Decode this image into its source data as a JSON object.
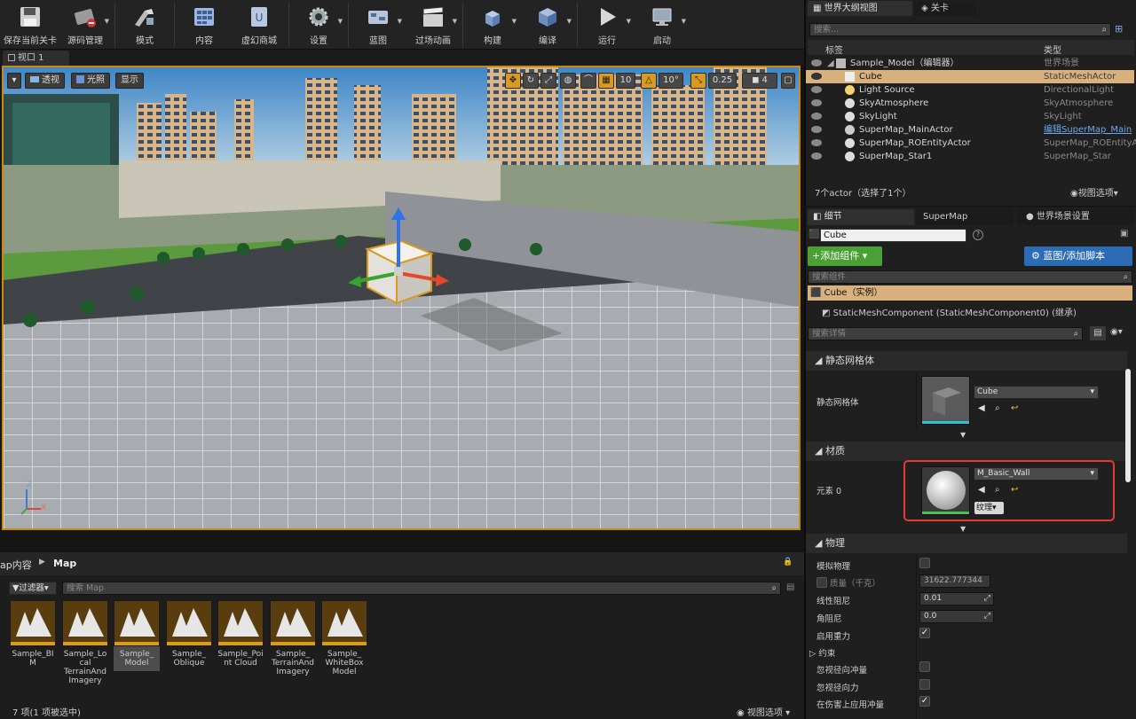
{
  "toolbar": {
    "items": [
      {
        "label": "保存当前关卡",
        "dropdown": false
      },
      {
        "label": "源码管理",
        "dropdown": true
      },
      {
        "label": "模式",
        "dropdown": false
      },
      {
        "label": "内容",
        "dropdown": false
      },
      {
        "label": "虚幻商城",
        "dropdown": false
      },
      {
        "label": "设置",
        "dropdown": true
      },
      {
        "label": "蓝图",
        "dropdown": true
      },
      {
        "label": "过场动画",
        "dropdown": true
      },
      {
        "label": "构建",
        "dropdown": true
      },
      {
        "label": "编译",
        "dropdown": true
      },
      {
        "label": "运行",
        "dropdown": true
      },
      {
        "label": "启动",
        "dropdown": true
      }
    ]
  },
  "viewport": {
    "tab": "视口 1",
    "perspective": "透视",
    "lit": "光照",
    "show": "显示",
    "grid_snap": "10",
    "rot_snap": "10°",
    "scale_snap": "0.25",
    "cam_speed": "4",
    "axis_z": "Z",
    "axis_x": "X",
    "accent": "#c98a14"
  },
  "content_browser": {
    "path_root": "ap内容",
    "path_current": "Map",
    "filter": "过滤器",
    "search_placeholder": "搜索 Map",
    "assets": [
      "Sample_BIM",
      "Sample_Local TerrainAnd Imagery",
      "Sample_ Model",
      "Sample_ Oblique",
      "Sample_Point Cloud",
      "Sample_ TerrainAnd Imagery",
      "Sample_ WhiteBox Model"
    ],
    "status": "7 项(1 项被选中)",
    "view_options": "视图选项"
  },
  "outliner": {
    "tab1": "世界大纲视图",
    "tab2": "关卡",
    "search_placeholder": "搜索...",
    "col_label": "标签",
    "col_type": "类型",
    "rows": [
      {
        "name": "Sample_Model（编辑器）",
        "type": "世界场景"
      },
      {
        "name": "Cube",
        "type": "StaticMeshActor"
      },
      {
        "name": "Light Source",
        "type": "DirectionalLight"
      },
      {
        "name": "SkyAtmosphere",
        "type": "SkyAtmosphere"
      },
      {
        "name": "SkyLight",
        "type": "SkyLight"
      },
      {
        "name": "SuperMap_MainActor",
        "type": "编辑SuperMap_Main"
      },
      {
        "name": "SuperMap_ROEntityActor",
        "type": "SuperMap_ROEntityAc"
      },
      {
        "name": "SuperMap_Star1",
        "type": "SuperMap_Star"
      }
    ],
    "footer": "7个actor（选择了1个）",
    "view_options": "视图选项"
  },
  "details": {
    "tab_details": "细节",
    "tab_supermap": "SuperMap",
    "tab_world": "世界场景设置",
    "name_value": "Cube",
    "add_component": "+添加组件",
    "blueprint": "蓝图/添加脚本",
    "search_components": "搜索组件",
    "instance": "Cube（实例）",
    "component": "StaticMeshComponent (StaticMeshComponent0) (继承)",
    "search_details": "搜索详情",
    "sec_static_mesh": "静态网格体",
    "prop_static_mesh": "静态网格体",
    "mesh_value": "Cube",
    "sec_material": "材质",
    "prop_element": "元素 0",
    "material_value": "M_Basic_Wall",
    "texture_btn": "纹理",
    "sec_physics": "物理",
    "props": [
      {
        "label": "模拟物理",
        "kind": "check",
        "checked": false
      },
      {
        "label": "质量（千克）",
        "kind": "num",
        "value": "31622.777344"
      },
      {
        "label": "线性阻尼",
        "kind": "num",
        "value": "0.01"
      },
      {
        "label": "角阻尼",
        "kind": "num",
        "value": "0.0"
      },
      {
        "label": "启用重力",
        "kind": "check",
        "checked": true
      },
      {
        "label": "约束",
        "kind": "group"
      },
      {
        "label": "忽视径向冲量",
        "kind": "check",
        "checked": false
      },
      {
        "label": "忽视径向力",
        "kind": "check",
        "checked": false
      },
      {
        "label": "在伤害上应用冲量",
        "kind": "check",
        "checked": true
      }
    ],
    "highlight_color": "#e53935"
  }
}
